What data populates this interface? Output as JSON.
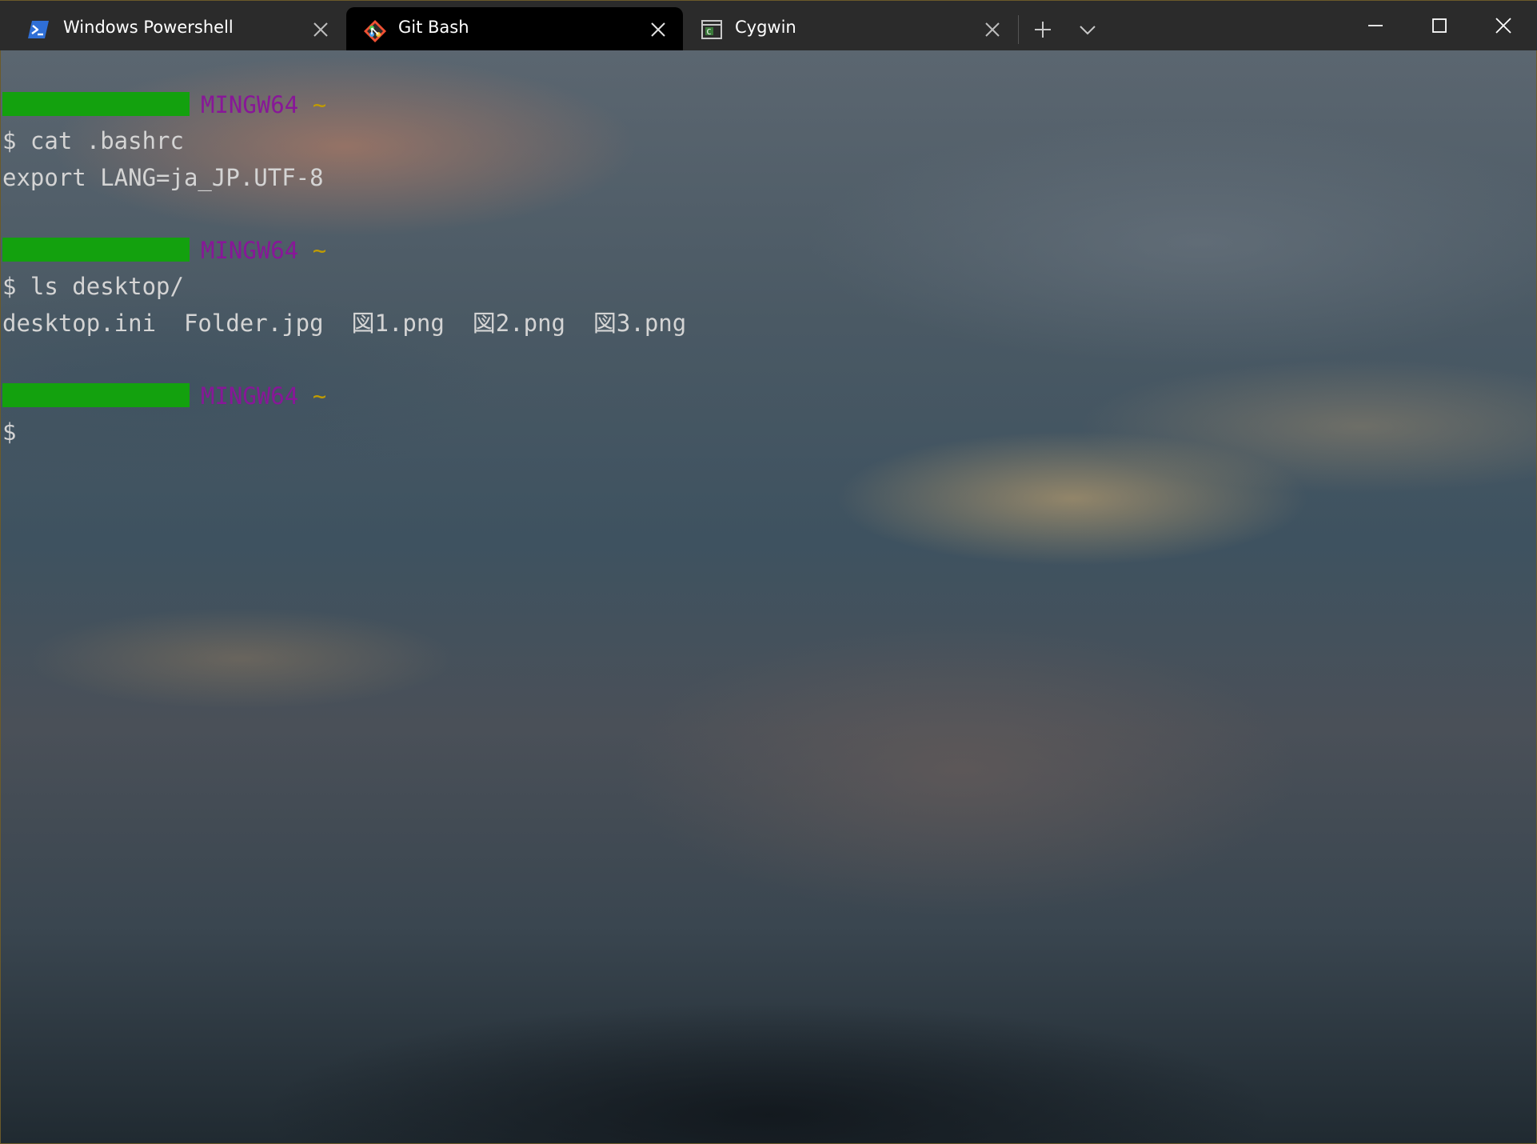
{
  "tabs": [
    {
      "label": "Windows Powershell",
      "icon": "powershell-icon",
      "active": false
    },
    {
      "label": "Git Bash",
      "icon": "git-bash-icon",
      "active": true
    },
    {
      "label": "Cygwin",
      "icon": "cygwin-terminal-icon",
      "active": false
    }
  ],
  "titlebar": {
    "new_tab_icon": "plus-icon",
    "dropdown_icon": "chevron-down-icon",
    "minimize_icon": "minimize-icon",
    "maximize_icon": "maximize-icon",
    "close_icon": "close-icon"
  },
  "terminal": {
    "prompts": [
      {
        "system": "MINGW64",
        "dir": "~",
        "command": "$ cat .bashrc"
      },
      {
        "system": "MINGW64",
        "dir": "~",
        "command": "$ ls desktop/"
      },
      {
        "system": "MINGW64",
        "dir": "~",
        "command": "$"
      }
    ],
    "outputs": [
      "export LANG=ja_JP.UTF-8",
      "desktop.ini  Folder.jpg  図1.png  図2.png  図3.png"
    ]
  },
  "colors": {
    "prompt_user_bar": "#13a10e",
    "prompt_system": "#881798",
    "prompt_dir": "#c19c00",
    "text": "#d4d4d4",
    "tabbar_bg": "#2b2b2b",
    "active_tab_bg": "#000000"
  }
}
